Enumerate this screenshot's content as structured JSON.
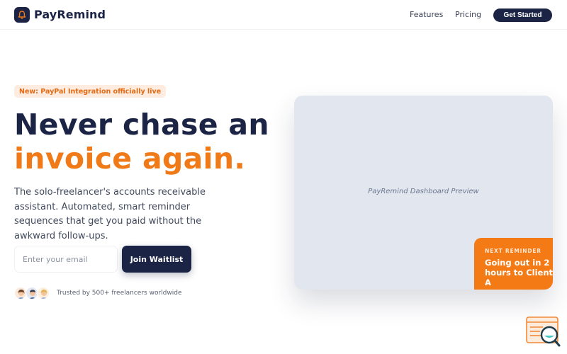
{
  "nav": {
    "brand": "PayRemind",
    "links": [
      "Features",
      "Pricing"
    ],
    "cta": "Get Started"
  },
  "hero": {
    "badge": "New: PayPal Integration officially live",
    "headline_line1": "Never chase an",
    "headline_line2": "invoice again.",
    "description": "The solo-freelancer's accounts receivable assistant. Automated, smart reminder sequences that get you paid without the awkward follow-ups.",
    "email_placeholder": "Enter your email",
    "join_button": "Join Waitlist",
    "trusted_text": "Trusted by 500+ freelancers worldwide",
    "avatar_icons": [
      "woman-avatar-icon",
      "man-avatar-icon",
      "woman-avatar-icon"
    ]
  },
  "preview": {
    "label": "PayRemind Dashboard Preview",
    "reminder_kicker": "NEXT REMINDER",
    "reminder_text": "Going out in 2 hours to Client A"
  },
  "colors": {
    "navy": "#1b2445",
    "orange": "#f07a18",
    "badge_bg": "#fdecdf",
    "card_bg": "#e2e7ef"
  }
}
